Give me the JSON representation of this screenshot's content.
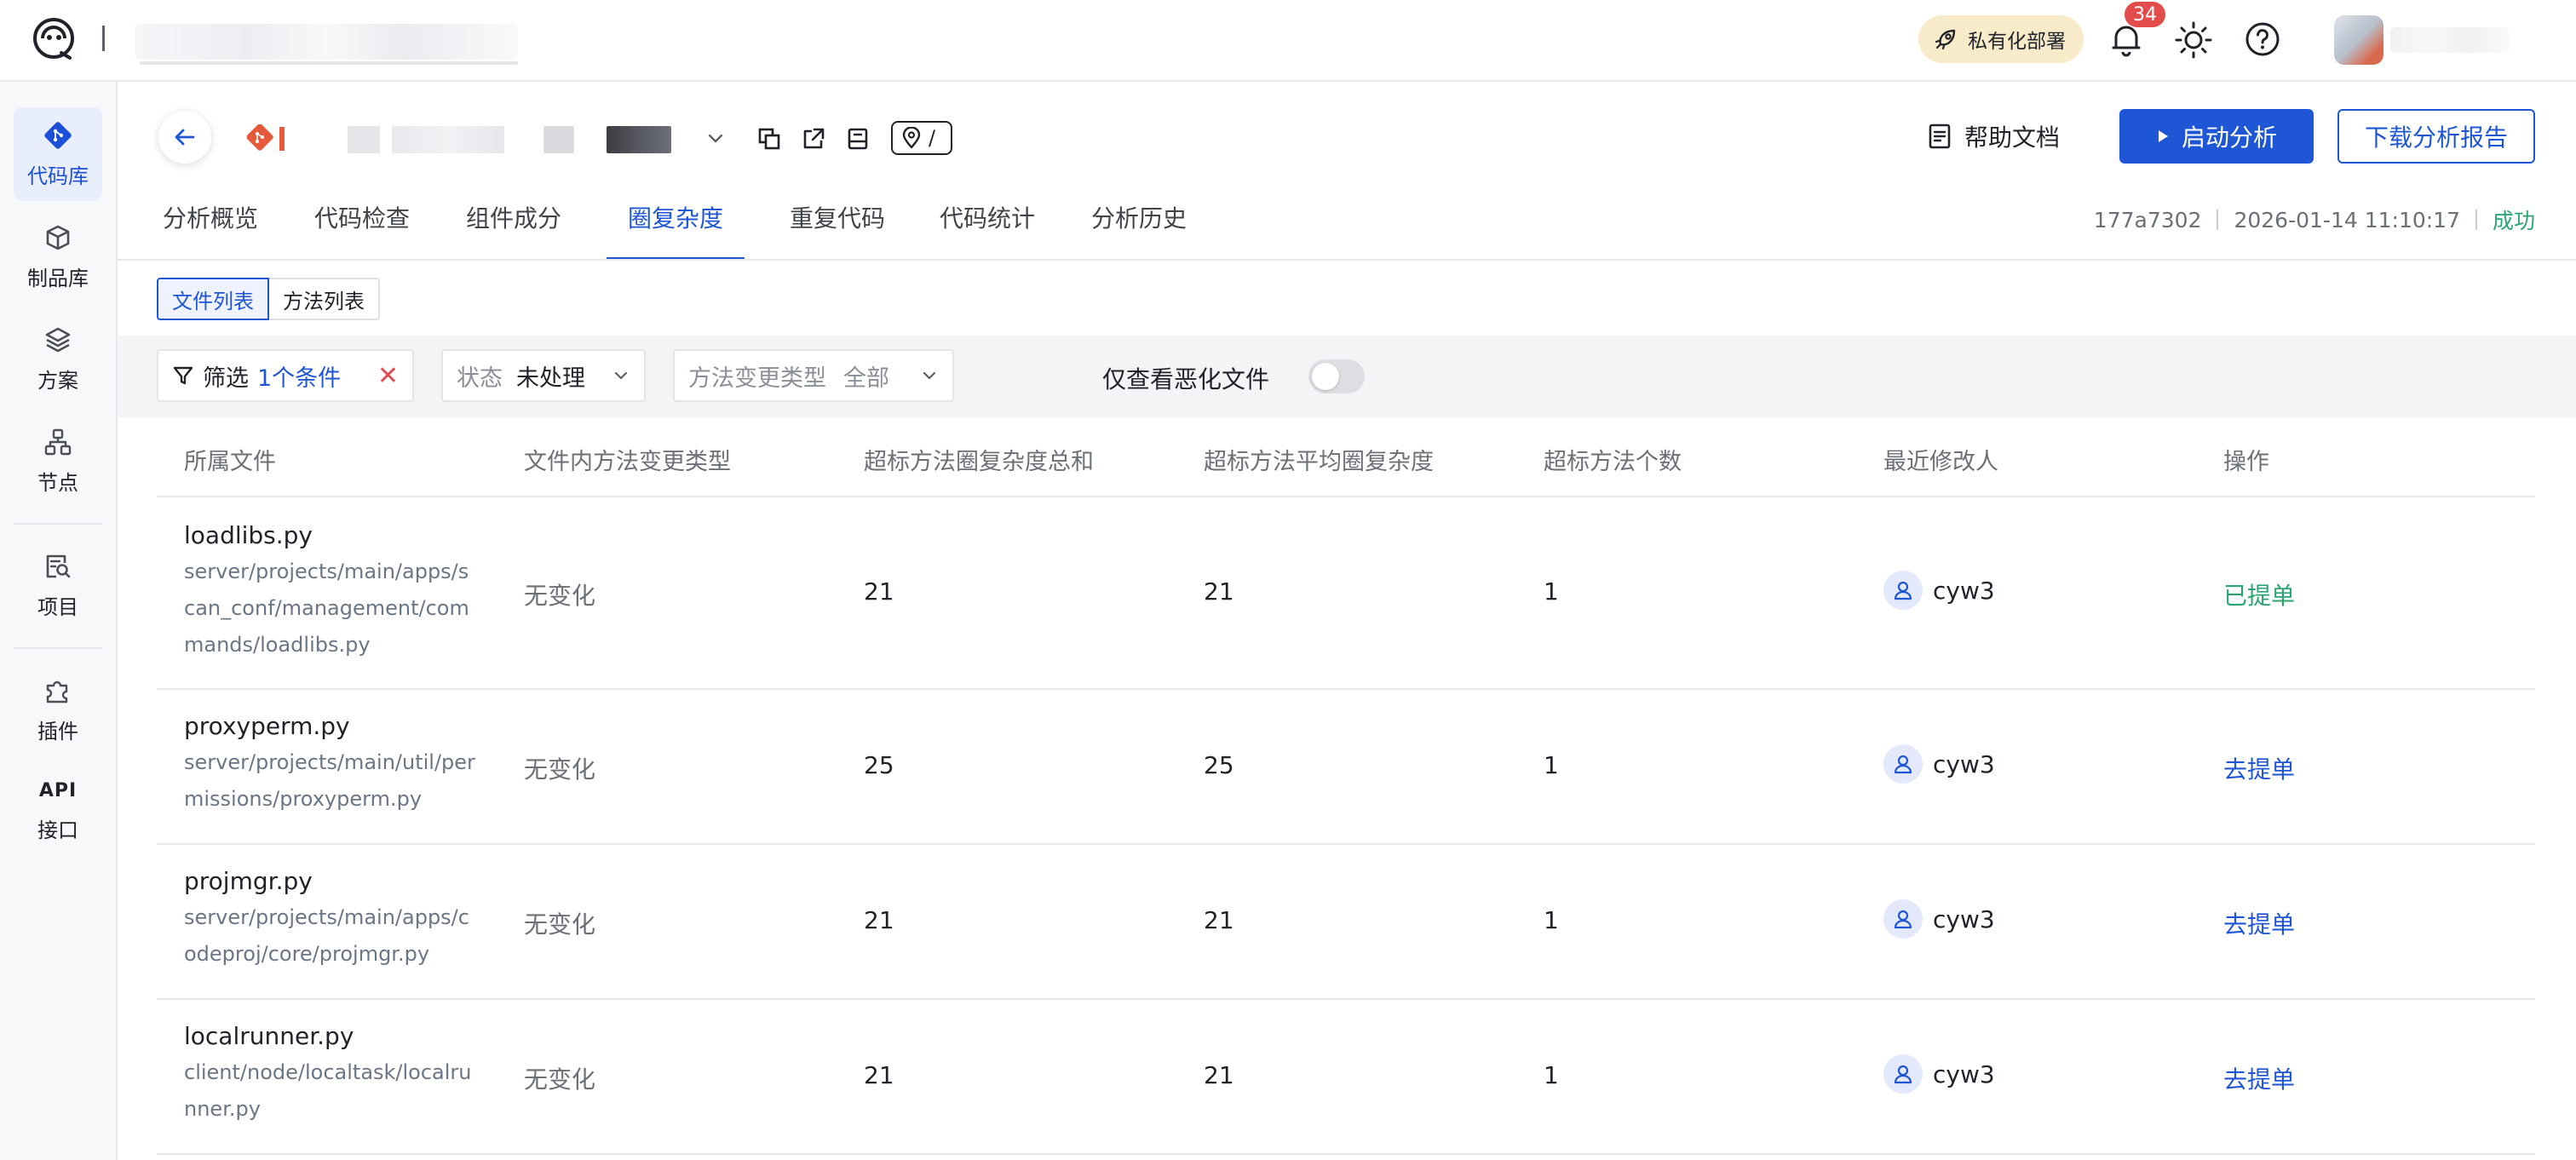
{
  "header": {
    "deploy_label": "私有化部署",
    "notif_count": "34"
  },
  "sidebar": {
    "items": [
      {
        "label": "代码库",
        "icon": "code-repo-icon"
      },
      {
        "label": "制品库",
        "icon": "package-icon"
      },
      {
        "label": "方案",
        "icon": "layers-icon"
      },
      {
        "label": "节点",
        "icon": "nodes-icon"
      },
      {
        "label": "项目",
        "icon": "project-search-icon"
      },
      {
        "label": "插件",
        "icon": "puzzle-icon"
      },
      {
        "label": "接口",
        "icon_text": "API"
      }
    ]
  },
  "repo": {
    "path_label": "/"
  },
  "actions": {
    "help_doc": "帮助文档",
    "start_analysis": "启动分析",
    "download_report": "下载分析报告"
  },
  "tabs": [
    "分析概览",
    "代码检查",
    "组件成分",
    "圈复杂度",
    "重复代码",
    "代码统计",
    "分析历史"
  ],
  "active_tab": "圈复杂度",
  "meta": {
    "commit": "177a7302",
    "datetime": "2026-01-14 11:10:17",
    "status": "成功"
  },
  "subtabs": [
    "文件列表",
    "方法列表"
  ],
  "filters": {
    "filter_label": "筛选",
    "filter_count": "1个条件",
    "clear_icon": "✕",
    "status_label": "状态",
    "status_value": "未处理",
    "change_type_label": "方法变更类型",
    "change_type_value": "全部",
    "only_worse_label": "仅查看恶化文件",
    "only_worse_on": false
  },
  "table": {
    "columns": [
      "所属文件",
      "文件内方法变更类型",
      "超标方法圈复杂度总和",
      "超标方法平均圈复杂度",
      "超标方法个数",
      "最近修改人",
      "操作"
    ],
    "rows": [
      {
        "file": "loadlibs.py",
        "path": "server/projects/main/apps/scan_conf/management/commands/loadlibs.py",
        "change": "无变化",
        "total": "21",
        "avg": "21",
        "count": "1",
        "user": "cyw3",
        "action": "已提单",
        "action_state": "done"
      },
      {
        "file": "proxyperm.py",
        "path": "server/projects/main/util/permissions/proxyperm.py",
        "change": "无变化",
        "total": "25",
        "avg": "25",
        "count": "1",
        "user": "cyw3",
        "action": "去提单",
        "action_state": "todo"
      },
      {
        "file": "projmgr.py",
        "path": "server/projects/main/apps/codeproj/core/projmgr.py",
        "change": "无变化",
        "total": "21",
        "avg": "21",
        "count": "1",
        "user": "cyw3",
        "action": "去提单",
        "action_state": "todo"
      },
      {
        "file": "localrunner.py",
        "path": "client/node/localtask/localrunner.py",
        "change": "无变化",
        "total": "21",
        "avg": "21",
        "count": "1",
        "user": "cyw3",
        "action": "去提单",
        "action_state": "todo"
      }
    ]
  },
  "colors": {
    "primary": "#1e56d6",
    "success": "#2ba471",
    "danger": "#e34d4d",
    "deploy_bg": "#f8ebc9"
  }
}
